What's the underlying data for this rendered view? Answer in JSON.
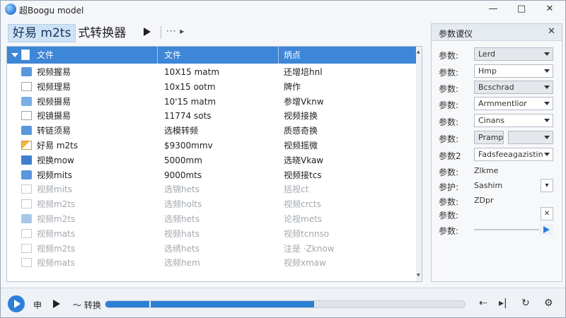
{
  "window": {
    "title": "超Boogu model",
    "controls": {
      "minimize": "—",
      "maximize": "□",
      "close": "✕"
    }
  },
  "toolbar": {
    "title_highlight": "好易 m2ts",
    "title_rest": "式转换器",
    "more": "··· ▸"
  },
  "table": {
    "headers": [
      "文件",
      "文件",
      "炳点"
    ],
    "rows": [
      {
        "icon": "folder-blue",
        "name": "视频握易",
        "size": "10X15 matm",
        "info": "还增培hnl",
        "faded": false
      },
      {
        "icon": "file-doc",
        "name": "视频理易",
        "size": "10x15 ootm",
        "info": "牌作",
        "faded": false
      },
      {
        "icon": "folder-blue-s",
        "name": "视频摄易",
        "size": "10'15 matm",
        "info": "参增Vknw",
        "faded": false
      },
      {
        "icon": "file-doc",
        "name": "视镜摄易",
        "size": "11774 sots",
        "info": "视频接换",
        "faded": false
      },
      {
        "icon": "folder-blue",
        "name": "转链须易",
        "size": "选模转频",
        "info": "质感奇换",
        "faded": false
      },
      {
        "icon": "file-orange",
        "name": "好易 m2ts",
        "size": "$9300mmv",
        "info": "视频摇微",
        "faded": false
      },
      {
        "icon": "file-mov",
        "name": "视换mow",
        "size": "5000mm",
        "info": "选晓Vkaw",
        "faded": false
      },
      {
        "icon": "folder-blue",
        "name": "视频mits",
        "size": "9000mts",
        "info": "视频接tcs",
        "faded": false
      },
      {
        "icon": "file-doc-f",
        "name": "视频mits",
        "size": "选锦hets",
        "info": "括视ct",
        "faded": true
      },
      {
        "icon": "file-doc-f",
        "name": "视频m2ts",
        "size": "选频holts",
        "info": "视频crcts",
        "faded": true
      },
      {
        "icon": "folder-blue-f",
        "name": "视频m2ts",
        "size": "选频hets",
        "info": "论视mets",
        "faded": true
      },
      {
        "icon": "file-doc-f",
        "name": "视频mats",
        "size": "视频hats",
        "info": "视频tcnnso",
        "faded": true
      },
      {
        "icon": "file-doc-f",
        "name": "视频m2ts",
        "size": "选绣hets",
        "info": "注是 ·Zknow",
        "faded": true
      },
      {
        "icon": "file-doc-f",
        "name": "视频mats",
        "size": "选频hem",
        "info": "视频xmaw",
        "faded": true
      }
    ]
  },
  "properties": {
    "title": "参数谡仪",
    "close": "✕",
    "rows": [
      {
        "label": "参数:",
        "type": "select",
        "value": "Lerd",
        "grey": true
      },
      {
        "label": "参数:",
        "type": "select",
        "value": "Hmp",
        "grey": false
      },
      {
        "label": "参数:",
        "type": "select",
        "value": "Bcschrad",
        "grey": true
      },
      {
        "label": "参数:",
        "type": "select",
        "value": "Armmentlior",
        "grey": false
      },
      {
        "label": "参数:",
        "type": "select",
        "value": "Cinans",
        "grey": false
      },
      {
        "label": "参数:",
        "type": "select-split",
        "value": "Pramp",
        "grey": true
      },
      {
        "label": "参数2",
        "type": "select",
        "value": "Fadsfeeagazistin",
        "grey": false
      },
      {
        "label": "参数:",
        "type": "text",
        "value": "Zlkme"
      },
      {
        "label": "参护:",
        "type": "text-btn",
        "value": "Sashim",
        "btn": "▾"
      },
      {
        "label": "参数:",
        "type": "text",
        "value": "ZDpr"
      },
      {
        "label": "参数:",
        "type": "btn",
        "btn": "✕"
      },
      {
        "label": "参数:",
        "type": "slider",
        "btn": "▶"
      }
    ]
  },
  "bottombar": {
    "label_a": "申",
    "label_convert": "〜 转换",
    "progress_value": 0.58,
    "icon_a": "⇠",
    "icon_b": "▸|",
    "icon_c": "↻",
    "icon_d": "⚙"
  },
  "colors": {
    "accent": "#2d7fd4",
    "header": "#3d86d8",
    "panel_bg": "#f7f8fa",
    "faded_text": "#a3a8ae"
  }
}
